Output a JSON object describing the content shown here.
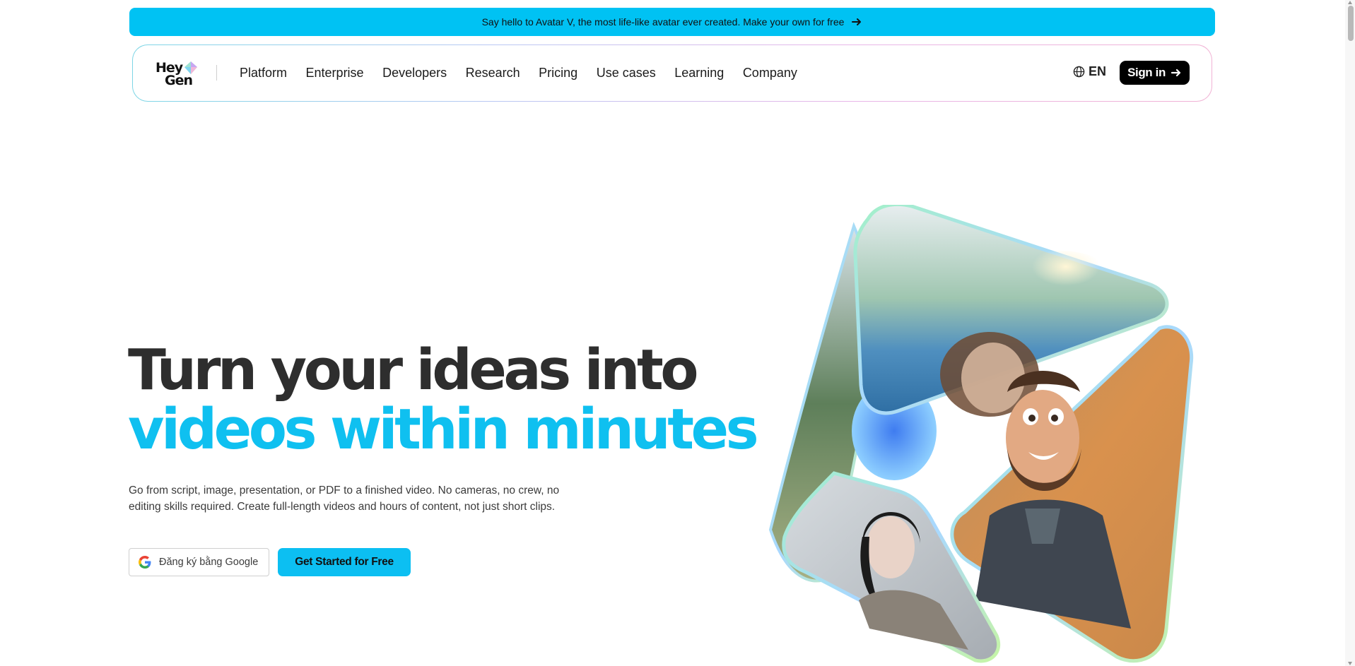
{
  "banner": {
    "text": "Say hello to Avatar V, the most life-like avatar ever created. Make your own for free"
  },
  "logo": {
    "line1": "Hey",
    "line2": "Gen"
  },
  "nav": {
    "items": [
      {
        "label": "Platform"
      },
      {
        "label": "Enterprise"
      },
      {
        "label": "Developers"
      },
      {
        "label": "Research"
      },
      {
        "label": "Pricing"
      },
      {
        "label": "Use cases"
      },
      {
        "label": "Learning"
      },
      {
        "label": "Company"
      }
    ],
    "language": "EN",
    "signin": "Sign in"
  },
  "hero": {
    "title_line1": "Turn your ideas into",
    "title_line2": "videos within minutes",
    "description": "Go from script, image, presentation, or PDF to a finished video. No cameras, no crew, no editing skills required. Create full-length videos and hours of content, not just short clips.",
    "google_button": "Đăng ký bằng Google",
    "cta_button": "Get Started for Free"
  },
  "colors": {
    "accent": "#00c2f3",
    "heading": "#2e2e2e",
    "heading_accent": "#0fc0f0",
    "signin_bg": "#000000"
  },
  "icons": {
    "banner_arrow": "arrow-right-icon",
    "globe": "globe-icon",
    "signin_arrow": "arrow-right-icon",
    "google": "google-g-icon",
    "logo_gem": "heygen-gem-icon"
  }
}
